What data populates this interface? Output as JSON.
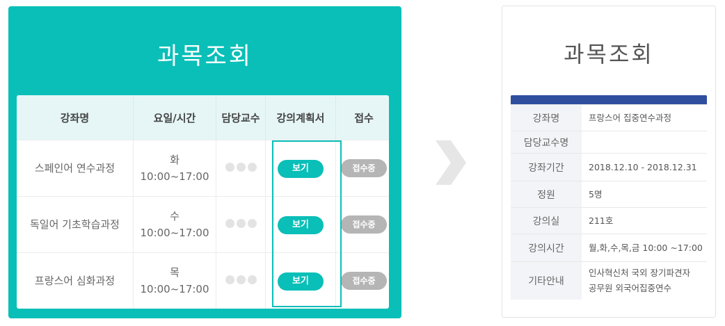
{
  "left": {
    "title": "과목조회",
    "headers": {
      "name": "강좌명",
      "time": "요일/시간",
      "professor": "담당교수",
      "plan": "강의계획서",
      "apply": "접수"
    },
    "rows": [
      {
        "name": "스페인어 연수과정",
        "day": "화",
        "time": "10:00~17:00",
        "view_label": "보기",
        "status": "접수중"
      },
      {
        "name": "독일어 기초학습과정",
        "day": "수",
        "time": "10:00~17:00",
        "view_label": "보기",
        "status": "접수중"
      },
      {
        "name": "프랑스어 심화과정",
        "day": "목",
        "time": "10:00~17:00",
        "view_label": "보기",
        "status": "접수중"
      }
    ]
  },
  "right": {
    "title": "과목조회",
    "rows": [
      {
        "label": "강좌명",
        "value": "프랑스어 집중연수과정"
      },
      {
        "label": "담당교수명",
        "value": ""
      },
      {
        "label": "강좌기간",
        "value": "2018.12.10 - 2018.12.31"
      },
      {
        "label": "정원",
        "value": "5명"
      },
      {
        "label": "강의실",
        "value": "211호"
      },
      {
        "label": "강의시간",
        "value": "월,화,수,목,금 10:00 ~17:00"
      },
      {
        "label": "기타안내",
        "value_line1": "인사혁신처 국외 장기파견자",
        "value_line2": "공무원 외국어집중연수"
      }
    ]
  },
  "colors": {
    "teal": "#09bfb8",
    "navy": "#2f4f9e",
    "gray_button": "#b5b5b5",
    "arrow": "#e6e6e6"
  },
  "icons": {
    "arrow": "chevron-right-icon",
    "professor_placeholder": "masked-name-dots-icon"
  }
}
